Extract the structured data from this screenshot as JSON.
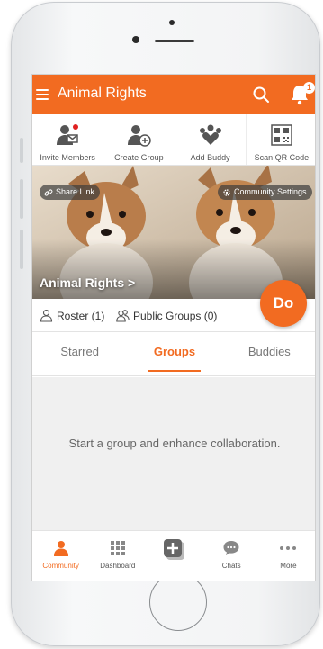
{
  "app": {
    "title": "Animal Rights",
    "notification_count": "1"
  },
  "actions": [
    {
      "label": "Invite Members"
    },
    {
      "label": "Create Group"
    },
    {
      "label": "Add Buddy"
    },
    {
      "label": "Scan QR Code"
    }
  ],
  "banner": {
    "share_link": "Share Link",
    "community_settings": "Community Settings",
    "community_name": "Animal Rights >",
    "do_button": "Do"
  },
  "stats": {
    "roster": "Roster (1)",
    "public_groups": "Public Groups (0)"
  },
  "tabs": [
    {
      "label": "Starred"
    },
    {
      "label": "Groups",
      "active": true
    },
    {
      "label": "Buddies"
    }
  ],
  "content": {
    "empty_message": "Start a group and enhance collaboration."
  },
  "bottom_nav": [
    {
      "label": "Community",
      "active": true,
      "icon": "community-icon"
    },
    {
      "label": "Dashboard",
      "icon": "dashboard-icon"
    },
    {
      "label": "",
      "icon": "add-icon"
    },
    {
      "label": "Chats",
      "icon": "chats-icon"
    },
    {
      "label": "More",
      "icon": "more-icon"
    }
  ],
  "colors": {
    "accent": "#f26b21",
    "background": "#f0f0f0"
  }
}
